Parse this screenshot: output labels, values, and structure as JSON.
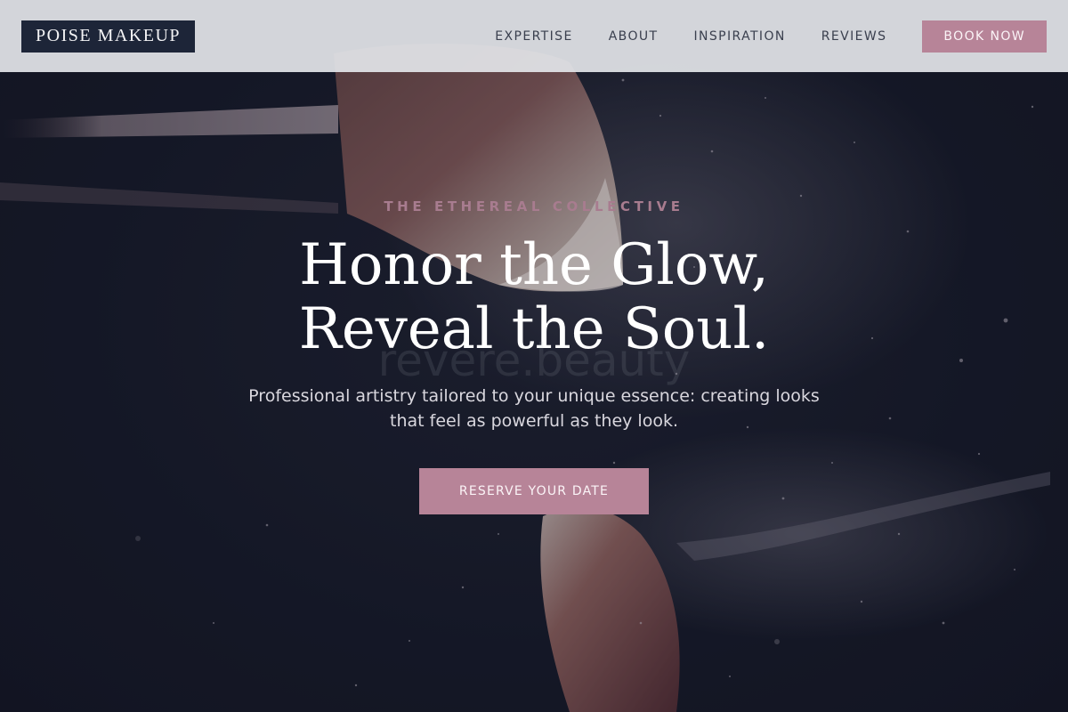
{
  "brand": {
    "name": "POISE MAKEUP"
  },
  "nav": {
    "items": [
      {
        "label": "EXPERTISE"
      },
      {
        "label": "ABOUT"
      },
      {
        "label": "INSPIRATION"
      },
      {
        "label": "REVIEWS"
      }
    ],
    "book_label": "BOOK NOW"
  },
  "hero": {
    "eyebrow": "THE ETHEREAL COLLECTIVE",
    "headline_line1": "Honor the Glow,",
    "headline_line2": "Reveal the Soul.",
    "watermark": "revere.beauty",
    "subtitle_line1": "Professional artistry tailored to your unique essence: creating looks",
    "subtitle_line2": "that feel as powerful as they look.",
    "cta_label": "RESERVE YOUR DATE",
    "background_image": "makeup-brush-powder-burst"
  },
  "colors": {
    "accent": "#b78498",
    "logo_bg": "#1d2538",
    "header_bg": "#e2e4e8",
    "hero_bg": "#161a26",
    "eyebrow": "#a87c8f"
  }
}
